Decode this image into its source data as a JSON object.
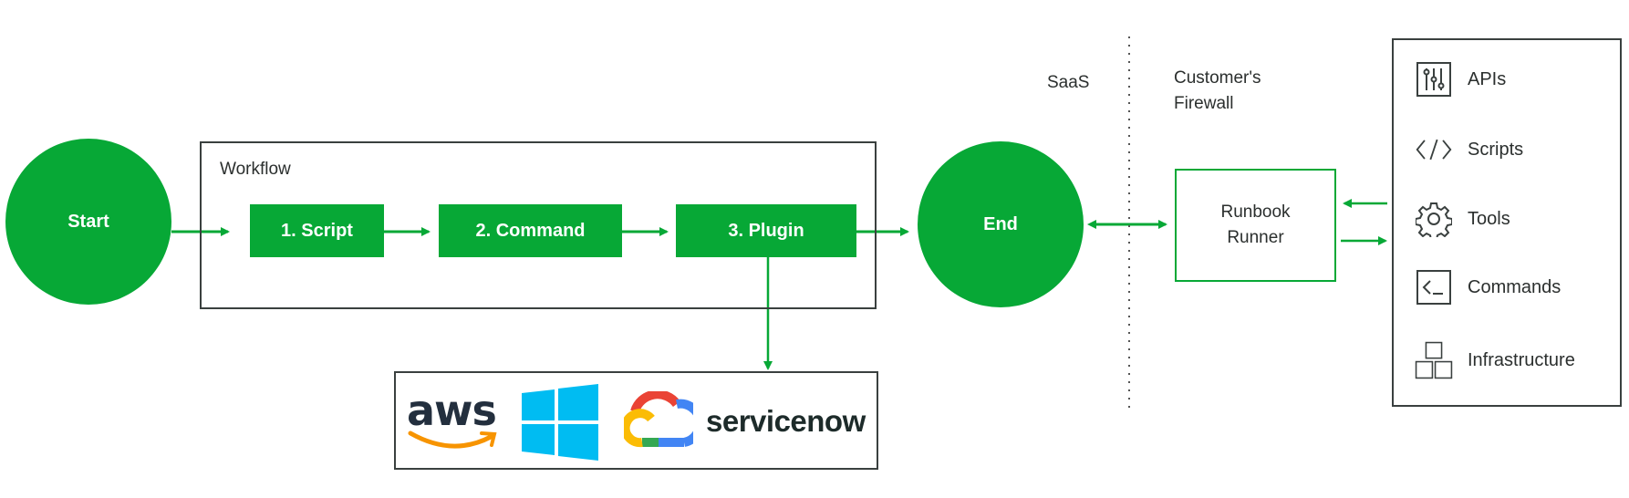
{
  "colors": {
    "accent": "#07a836",
    "border": "#3a403f",
    "aws_orange": "#f79400",
    "windows_blue": "#00bcf2",
    "servicenow_dark": "#1d2b2a",
    "servicenow_green": "#7fc0a6"
  },
  "flow": {
    "start": "Start",
    "workflow_title": "Workflow",
    "steps": [
      {
        "label": "1. Script"
      },
      {
        "label": "2. Command"
      },
      {
        "label": "3. Plugin"
      }
    ],
    "end": "End"
  },
  "zones": {
    "saas": "SaaS",
    "customer_line1": "Customer's",
    "customer_line2": "Firewall"
  },
  "runner": {
    "line1": "Runbook",
    "line2": "Runner"
  },
  "resources": [
    {
      "label": "APIs",
      "icon": "sliders-icon"
    },
    {
      "label": "Scripts",
      "icon": "code-icon"
    },
    {
      "label": "Tools",
      "icon": "gear-icon"
    },
    {
      "label": "Commands",
      "icon": "terminal-icon"
    },
    {
      "label": "Infrastructure",
      "icon": "boxes-icon"
    }
  ],
  "plugins": {
    "aws": "aws",
    "windows": "Windows",
    "gcloud": "Google Cloud",
    "servicenow": "servicenow"
  }
}
